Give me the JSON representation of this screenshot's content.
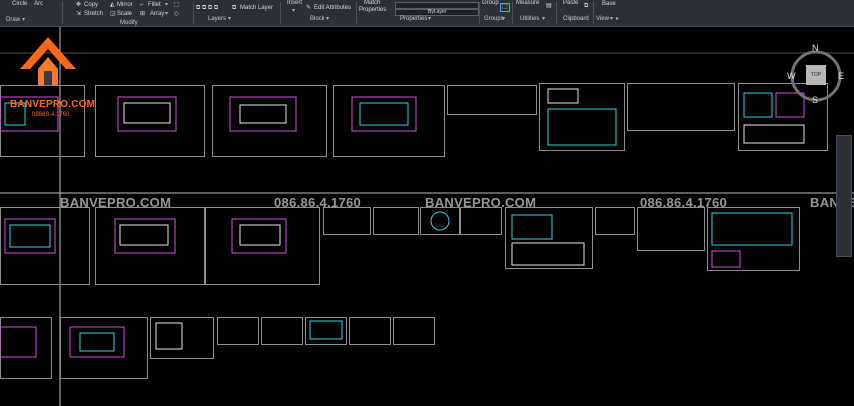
{
  "ribbon": {
    "draw": {
      "circle": "Circle",
      "arc": "Arc",
      "panel": "Draw"
    },
    "modify": {
      "copy": "Copy",
      "mirror": "Mirror",
      "fillet": "Fillet",
      "stretch": "Stretch",
      "scale": "Scale",
      "array": "Array",
      "panel": "Modify"
    },
    "layers": {
      "match_layer": "Match Layer",
      "panel": "Layers"
    },
    "block": {
      "insert": "Insert",
      "edit_attributes": "Edit Attributes",
      "panel": "Block"
    },
    "properties": {
      "match": "Match",
      "match2": "Properties",
      "bylayer": "ByLayer",
      "panel": "Properties"
    },
    "groups": {
      "group": "Group",
      "panel": "Groups"
    },
    "utilities": {
      "measure": "Measure",
      "panel": "Utilities"
    },
    "clipboard": {
      "paste": "Paste",
      "panel": "Clipboard"
    },
    "view": {
      "base": "Base",
      "panel": "View"
    }
  },
  "logo": {
    "brand": "BANVEPRO.COM",
    "phone": "0868S.4.1760",
    "colors": {
      "orange": "#ff6a1a",
      "dark": "#3a3a3a"
    }
  },
  "watermarks": [
    "BANVEPRO.COM",
    "086.86.4.1760",
    "BANVEPRO.COM",
    "086.86.4.1760",
    "BANVE"
  ],
  "navcube": {
    "n": "N",
    "w": "W",
    "e": "E",
    "s": "S",
    "top": "TOP"
  },
  "colors": {
    "sheet_border": "#8a8e93",
    "magenta": "#d24fd8",
    "cyan": "#35d1e0",
    "white": "#e6e6e6"
  }
}
